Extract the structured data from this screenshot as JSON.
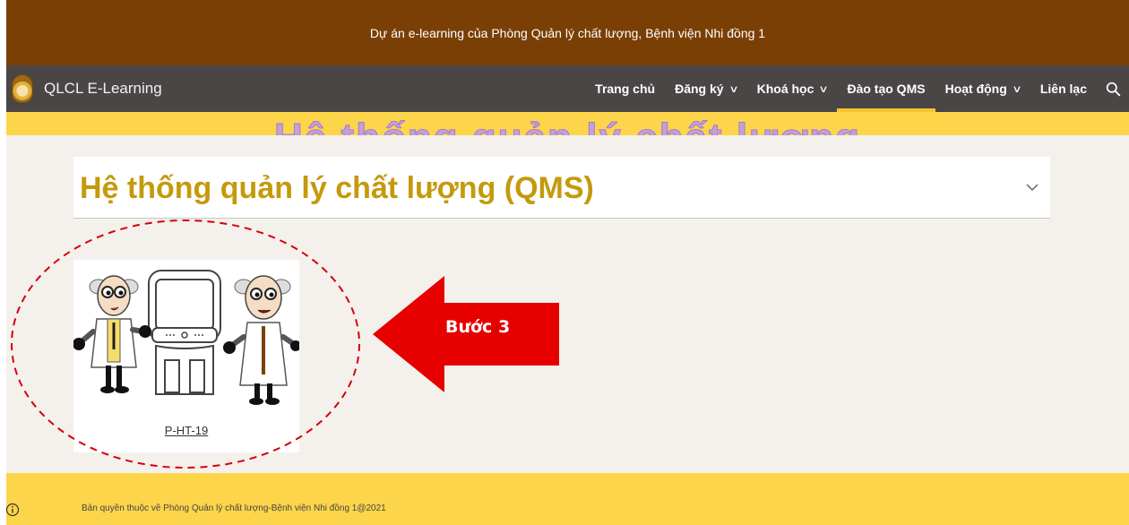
{
  "announcement": "Dự án e-learning của Phòng Quản lý chất lượng, Bệnh viện Nhi đồng 1",
  "brand": {
    "name": "QLCL E-Learning",
    "logo_icon": "hospital-logo-icon"
  },
  "nav": {
    "items": [
      {
        "label": "Trang chủ",
        "has_dropdown": false
      },
      {
        "label": "Đăng ký",
        "has_dropdown": true
      },
      {
        "label": "Khoá học",
        "has_dropdown": true
      },
      {
        "label": "Đào tạo QMS",
        "has_dropdown": false,
        "active": true
      },
      {
        "label": "Hoạt động",
        "has_dropdown": true
      },
      {
        "label": "Liên lạc",
        "has_dropdown": false
      }
    ],
    "search_icon": "search-icon"
  },
  "banner": {
    "text": "Hệ thống quản lý chất lượng"
  },
  "section": {
    "title": "Hệ thống quản lý chất lượng (QMS)",
    "toggle_icon": "chevron-down-icon"
  },
  "courses": [
    {
      "label": "P-HT-19"
    }
  ],
  "annotation": {
    "label": "Bước 3"
  },
  "footer": {
    "copyright": "Bản quyền thuộc về Phòng Quản lý chất lượng-Bệnh viện Nhi đồng 1@2021",
    "info_icon": "info-icon"
  },
  "colors": {
    "top_bar": "#7a3f05",
    "nav_bar": "#4a4646",
    "accent_yellow": "#fdd54a",
    "title_gold": "#c49a0d",
    "annotation_red": "#e60000"
  }
}
